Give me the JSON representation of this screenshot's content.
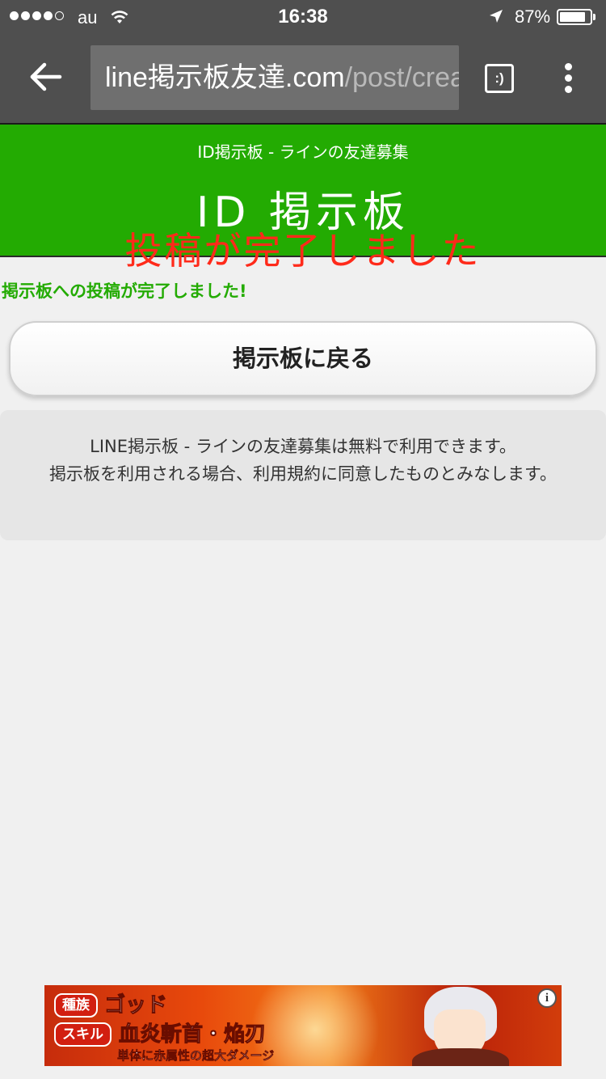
{
  "status_bar": {
    "carrier": "au",
    "time": "16:38",
    "battery_percent": "87%",
    "battery_level": 0.87,
    "signal_bars_filled": 4,
    "signal_bars_total": 5
  },
  "browser": {
    "url_host": "line掲示板友達.com",
    "url_path": "/post/crea",
    "tab_button_label": ":)",
    "icons": [
      "back-arrow-icon",
      "tab-switcher-icon",
      "overflow-menu-icon"
    ]
  },
  "header": {
    "subtitle": "ID掲示板 - ラインの友達募集",
    "logo_text": "ID 掲示板",
    "overlay_text": "投稿が完了しました",
    "colors": {
      "background": "#23ab02",
      "overlay": "#ff2a1a"
    }
  },
  "main": {
    "notice": "掲示板への投稿が完了しました!",
    "return_button_label": "掲示板に戻る",
    "info_line1": "LINE掲示板 - ラインの友達募集は無料で利用できます。",
    "info_line2": "掲示板を利用される場合、利用規約に同意したものとみなします。",
    "colors": {
      "accent": "#23ab02"
    }
  },
  "ad": {
    "tag_race": "種族",
    "race_value": "ゴッド",
    "tag_skill": "スキル",
    "skill_name": "血炎斬首・焔刃",
    "caption": "単体に赤属性の超大ダメージ",
    "info_icon": "i"
  }
}
